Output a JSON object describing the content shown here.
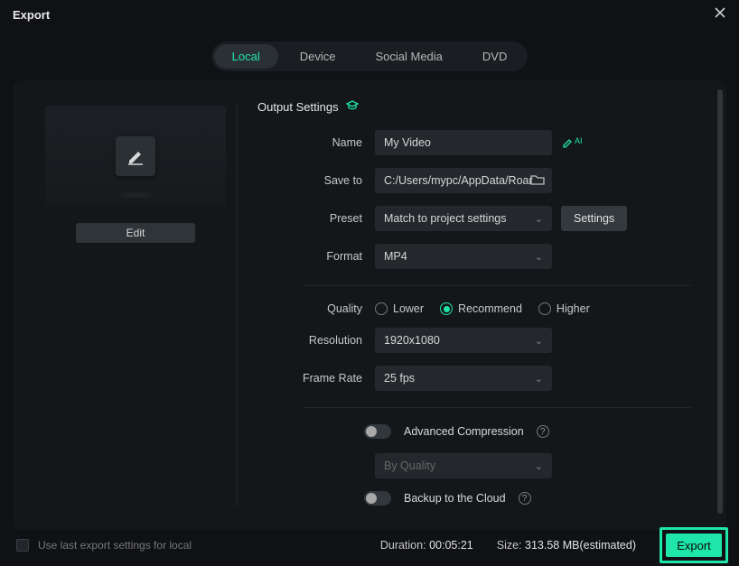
{
  "window": {
    "title": "Export"
  },
  "tabs": {
    "local": "Local",
    "device": "Device",
    "social": "Social Media",
    "dvd": "DVD"
  },
  "left": {
    "edit": "Edit"
  },
  "section_title": "Output Settings",
  "labels": {
    "name": "Name",
    "saveto": "Save to",
    "preset": "Preset",
    "format": "Format",
    "quality": "Quality",
    "resolution": "Resolution",
    "framerate": "Frame Rate"
  },
  "values": {
    "name": "My Video",
    "saveto": "C:/Users/mypc/AppData/Roar",
    "preset": "Match to project settings",
    "format": "MP4",
    "resolution": "1920x1080",
    "framerate": "25 fps",
    "compression_mode": "By Quality"
  },
  "buttons": {
    "settings": "Settings",
    "export": "Export"
  },
  "quality": {
    "lower": "Lower",
    "recommend": "Recommend",
    "higher": "Higher"
  },
  "toggles": {
    "advcomp": "Advanced Compression",
    "backup": "Backup to the Cloud"
  },
  "footer": {
    "uselast": "Use last export settings for local",
    "duration_label": "Duration:",
    "duration": "00:05:21",
    "size_label": "Size:",
    "size": "313.58 MB(estimated)"
  },
  "ai_suffix": "AI"
}
